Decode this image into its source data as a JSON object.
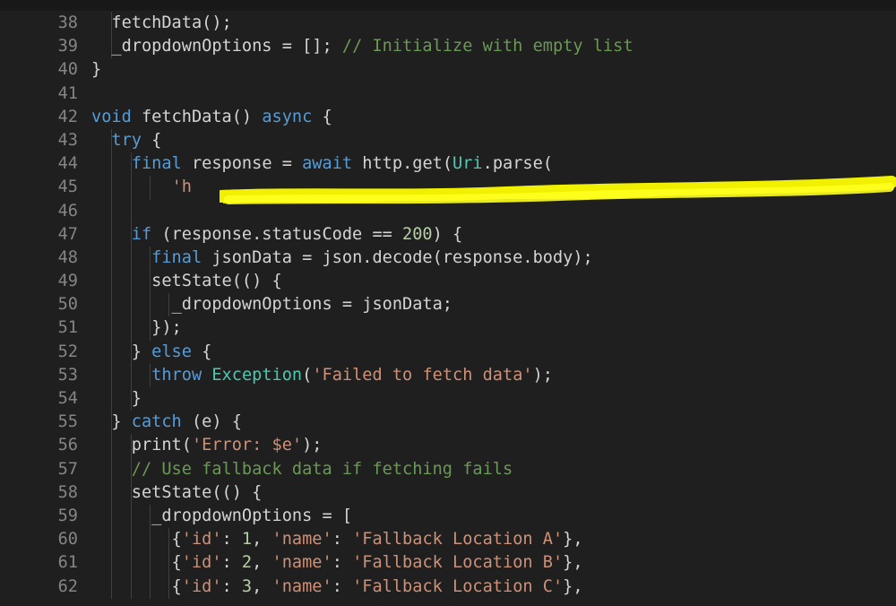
{
  "editor": {
    "lines": [
      {
        "num": "38",
        "indent": 1,
        "tokens": [
          [
            "plain",
            "  fetchData();"
          ]
        ]
      },
      {
        "num": "39",
        "indent": 1,
        "tokens": [
          [
            "plain",
            "  _dropdownOptions = []; "
          ],
          [
            "cmt",
            "// Initialize with empty list"
          ]
        ]
      },
      {
        "num": "40",
        "indent": 0,
        "tokens": [
          [
            "plain",
            "}"
          ]
        ]
      },
      {
        "num": "41",
        "indent": 0,
        "tokens": []
      },
      {
        "num": "42",
        "indent": 0,
        "tokens": [
          [
            "kw",
            "void"
          ],
          [
            "plain",
            " fetchData() "
          ],
          [
            "kw",
            "async"
          ],
          [
            "plain",
            " {"
          ]
        ]
      },
      {
        "num": "43",
        "indent": 1,
        "tokens": [
          [
            "plain",
            "  "
          ],
          [
            "kw",
            "try"
          ],
          [
            "plain",
            " {"
          ]
        ]
      },
      {
        "num": "44",
        "indent": 2,
        "tokens": [
          [
            "plain",
            "    "
          ],
          [
            "kw",
            "final"
          ],
          [
            "plain",
            " response = "
          ],
          [
            "kw",
            "await"
          ],
          [
            "plain",
            " http.get("
          ],
          [
            "typ",
            "Uri"
          ],
          [
            "plain",
            ".parse("
          ]
        ]
      },
      {
        "num": "45",
        "indent": 3,
        "tokens": [
          [
            "plain",
            "        "
          ],
          [
            "str",
            "'h"
          ]
        ]
      },
      {
        "num": "46",
        "indent": 2,
        "tokens": []
      },
      {
        "num": "47",
        "indent": 2,
        "tokens": [
          [
            "plain",
            "    "
          ],
          [
            "kw",
            "if"
          ],
          [
            "plain",
            " (response.statusCode == "
          ],
          [
            "num",
            "200"
          ],
          [
            "plain",
            ") {"
          ]
        ]
      },
      {
        "num": "48",
        "indent": 3,
        "tokens": [
          [
            "plain",
            "      "
          ],
          [
            "kw",
            "final"
          ],
          [
            "plain",
            " jsonData = json.decode(response.body);"
          ]
        ]
      },
      {
        "num": "49",
        "indent": 3,
        "tokens": [
          [
            "plain",
            "      setState(() {"
          ]
        ]
      },
      {
        "num": "50",
        "indent": 4,
        "tokens": [
          [
            "plain",
            "        _dropdownOptions = jsonData;"
          ]
        ]
      },
      {
        "num": "51",
        "indent": 3,
        "tokens": [
          [
            "plain",
            "      });"
          ]
        ]
      },
      {
        "num": "52",
        "indent": 2,
        "tokens": [
          [
            "plain",
            "    } "
          ],
          [
            "kw",
            "else"
          ],
          [
            "plain",
            " {"
          ]
        ]
      },
      {
        "num": "53",
        "indent": 3,
        "tokens": [
          [
            "plain",
            "      "
          ],
          [
            "kw",
            "throw"
          ],
          [
            "plain",
            " "
          ],
          [
            "typ",
            "Exception"
          ],
          [
            "plain",
            "("
          ],
          [
            "str",
            "'Failed to fetch data'"
          ],
          [
            "plain",
            ");"
          ]
        ]
      },
      {
        "num": "54",
        "indent": 2,
        "tokens": [
          [
            "plain",
            "    }"
          ]
        ]
      },
      {
        "num": "55",
        "indent": 1,
        "tokens": [
          [
            "plain",
            "  } "
          ],
          [
            "kw",
            "catch"
          ],
          [
            "plain",
            " (e) {"
          ]
        ]
      },
      {
        "num": "56",
        "indent": 2,
        "tokens": [
          [
            "plain",
            "    print("
          ],
          [
            "str",
            "'Error: $e'"
          ],
          [
            "plain",
            ");"
          ]
        ]
      },
      {
        "num": "57",
        "indent": 2,
        "tokens": [
          [
            "plain",
            "    "
          ],
          [
            "cmt",
            "// Use fallback data if fetching fails"
          ]
        ]
      },
      {
        "num": "58",
        "indent": 2,
        "tokens": [
          [
            "plain",
            "    setState(() {"
          ]
        ]
      },
      {
        "num": "59",
        "indent": 3,
        "tokens": [
          [
            "plain",
            "      _dropdownOptions = ["
          ]
        ]
      },
      {
        "num": "60",
        "indent": 4,
        "tokens": [
          [
            "plain",
            "        {"
          ],
          [
            "str",
            "'id'"
          ],
          [
            "plain",
            ": "
          ],
          [
            "num",
            "1"
          ],
          [
            "plain",
            ", "
          ],
          [
            "str",
            "'name'"
          ],
          [
            "plain",
            ": "
          ],
          [
            "str",
            "'Fallback Location A'"
          ],
          [
            "plain",
            "},"
          ]
        ]
      },
      {
        "num": "61",
        "indent": 4,
        "tokens": [
          [
            "plain",
            "        {"
          ],
          [
            "str",
            "'id'"
          ],
          [
            "plain",
            ": "
          ],
          [
            "num",
            "2"
          ],
          [
            "plain",
            ", "
          ],
          [
            "str",
            "'name'"
          ],
          [
            "plain",
            ": "
          ],
          [
            "str",
            "'Fallback Location B'"
          ],
          [
            "plain",
            "},"
          ]
        ]
      },
      {
        "num": "62",
        "indent": 4,
        "tokens": [
          [
            "plain",
            "        {"
          ],
          [
            "str",
            "'id'"
          ],
          [
            "plain",
            ": "
          ],
          [
            "num",
            "3"
          ],
          [
            "plain",
            ", "
          ],
          [
            "str",
            "'name'"
          ],
          [
            "plain",
            ": "
          ],
          [
            "str",
            "'Fallback Location C'"
          ],
          [
            "plain",
            "},"
          ]
        ]
      }
    ],
    "colors": {
      "background": "#1f1f1f",
      "keyword": "#569cd6",
      "string": "#ce9178",
      "number": "#b5cea8",
      "comment": "#6a9955",
      "type": "#4ec9b0",
      "text": "#d4d4d4",
      "line_number": "#858585",
      "redaction_highlight": "#f5f500"
    }
  }
}
